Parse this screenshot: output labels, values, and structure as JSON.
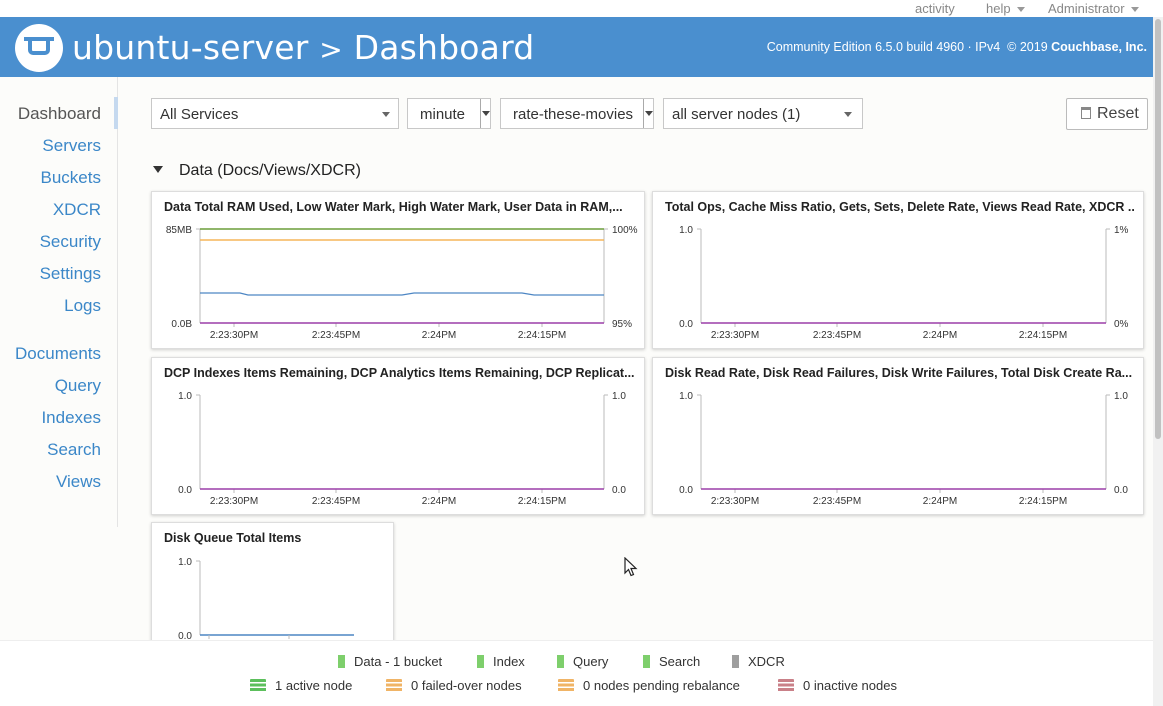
{
  "topbar": {
    "activity": "activity",
    "help": "help",
    "user": "Administrator"
  },
  "header": {
    "host": "ubuntu-server",
    "separator": ">",
    "page": "Dashboard",
    "edition": "Community Edition 6.5.0 build 4960 · IPv4",
    "copyright_prefix": "© 2019",
    "company": "Couchbase, Inc."
  },
  "sidebar": {
    "items": [
      {
        "label": "Dashboard",
        "active": true
      },
      {
        "label": "Servers"
      },
      {
        "label": "Buckets"
      },
      {
        "label": "XDCR"
      },
      {
        "label": "Security"
      },
      {
        "label": "Settings"
      },
      {
        "label": "Logs"
      },
      {
        "label": "Documents"
      },
      {
        "label": "Query"
      },
      {
        "label": "Indexes"
      },
      {
        "label": "Search"
      },
      {
        "label": "Views"
      }
    ]
  },
  "filters": {
    "services": "All Services",
    "zoom": "minute",
    "bucket": "rate-these-movies",
    "nodes": "all server nodes (1)"
  },
  "reset_label": "Reset",
  "section_title": "Data (Docs/Views/XDCR)",
  "colors": {
    "header_blue": "#4a8fcf",
    "link_blue": "#3b87c8",
    "service_green": "#7ecf6c",
    "service_gray": "#9e9e9e",
    "failed_orange": "#f0b466",
    "inactive_red": "#c98088",
    "line_green": "#6b9e3a",
    "line_orange": "#f5b65a",
    "line_blue": "#4d86c4",
    "line_purple": "#9b3ea8"
  },
  "charts": [
    {
      "title": "Data Total RAM Used, Low Water Mark, High Water Mark, User Data in RAM,...",
      "y_left": [
        "85MB",
        "0.0B"
      ],
      "y_right": [
        "100%",
        "95%"
      ],
      "x_ticks": [
        "2:23:30PM",
        "2:23:45PM",
        "2:24PM",
        "2:24:15PM"
      ]
    },
    {
      "title": "Total Ops, Cache Miss Ratio, Gets, Sets, Delete Rate, Views Read Rate, XDCR ...",
      "y_left": [
        "1.0",
        "0.0"
      ],
      "y_right": [
        "1%",
        "0%"
      ],
      "x_ticks": [
        "2:23:30PM",
        "2:23:45PM",
        "2:24PM",
        "2:24:15PM"
      ]
    },
    {
      "title": "DCP Indexes Items Remaining, DCP Analytics Items Remaining, DCP Replicat...",
      "y_left": [
        "1.0",
        "0.0"
      ],
      "y_right": [
        "1.0",
        "0.0"
      ],
      "x_ticks": [
        "2:23:30PM",
        "2:23:45PM",
        "2:24PM",
        "2:24:15PM"
      ]
    },
    {
      "title": "Disk Read Rate, Disk Read Failures, Disk Write Failures, Total Disk Create Ra...",
      "y_left": [
        "1.0",
        "0.0"
      ],
      "y_right": [
        "1.0",
        "0.0"
      ],
      "x_ticks": [
        "2:23:30PM",
        "2:23:45PM",
        "2:24PM",
        "2:24:15PM"
      ]
    },
    {
      "title": "Disk Queue Total Items",
      "y_left": [
        "1.0",
        "0.0"
      ],
      "y_right": [],
      "x_ticks": []
    }
  ],
  "footer": {
    "services": [
      {
        "label": "Data - 1 bucket",
        "color": "#7ecf6c"
      },
      {
        "label": "Index",
        "color": "#7ecf6c"
      },
      {
        "label": "Query",
        "color": "#7ecf6c"
      },
      {
        "label": "Search",
        "color": "#7ecf6c"
      },
      {
        "label": "XDCR",
        "color": "#9e9e9e"
      }
    ],
    "nodes": [
      {
        "label": "1 active node",
        "color": "#5cbf5c"
      },
      {
        "label": "0 failed-over nodes",
        "color": "#f0b466"
      },
      {
        "label": "0 nodes pending rebalance",
        "color": "#f0b466"
      },
      {
        "label": "0 inactive nodes",
        "color": "#c98088"
      }
    ]
  }
}
